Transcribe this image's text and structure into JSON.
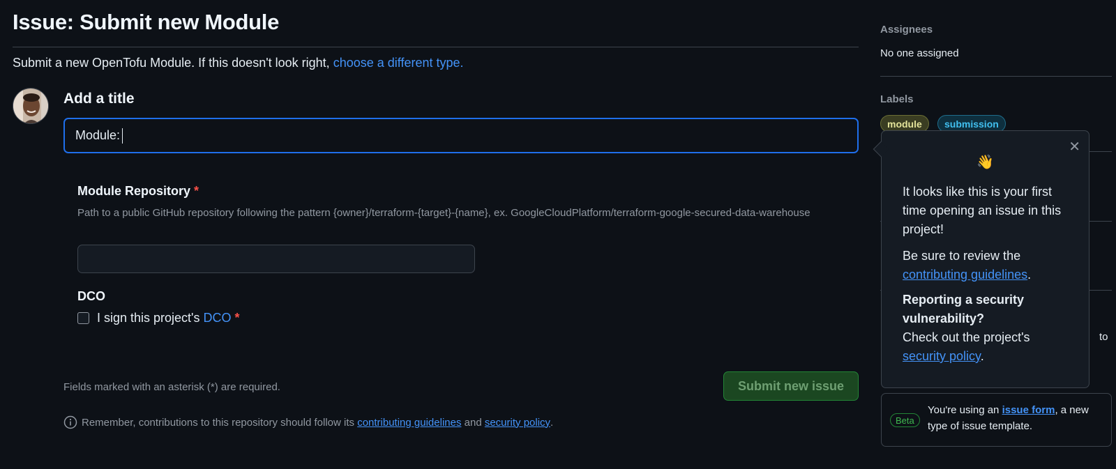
{
  "page": {
    "title": "Issue: Submit new Module",
    "intro_text": "Submit a new OpenTofu Module. If this doesn't look right,",
    "intro_link": "choose a different type."
  },
  "form": {
    "title_label": "Add a title",
    "title_value": "Module:",
    "repo_label": "Module Repository",
    "required_mark": "*",
    "repo_help": "Path to a public GitHub repository following the pattern {owner}/terraform-{target}-{name}, ex. GoogleCloudPlatform/terraform-google-secured-data-warehouse",
    "dco_label": "DCO",
    "dco_checkbox_text": "I sign this project's",
    "dco_link": "DCO",
    "required_note": "Fields marked with an asterisk (*) are required.",
    "submit_label": "Submit new issue",
    "remember_text": "Remember, contributions to this repository should follow its",
    "remember_link1": "contributing guidelines",
    "remember_and": "and",
    "remember_link2": "security policy",
    "remember_end": "."
  },
  "sidebar": {
    "assignees_heading": "Assignees",
    "assignees_value": "No one assigned",
    "labels_heading": "Labels",
    "labels": [
      "module",
      "submission"
    ],
    "partial_text": "to"
  },
  "popover": {
    "emoji": "👋",
    "p1": "It looks like this is your first time opening an issue in this project!",
    "p2_text": "Be sure to review the",
    "p2_link": "contributing guidelines",
    "p2_end": ".",
    "p3_bold": "Reporting a security vulnerability?",
    "p3_text": "Check out the project's",
    "p3_link": "security policy",
    "p3_end": "."
  },
  "beta": {
    "badge": "Beta",
    "text_start": "You're using an",
    "link": "issue form",
    "text_end": ", a new type of issue template."
  },
  "colors": {
    "background": "#0d1117",
    "link": "#4493f8",
    "focus_border": "#1f6feb",
    "required": "#f85149",
    "submit_bg": "#1b4721"
  }
}
